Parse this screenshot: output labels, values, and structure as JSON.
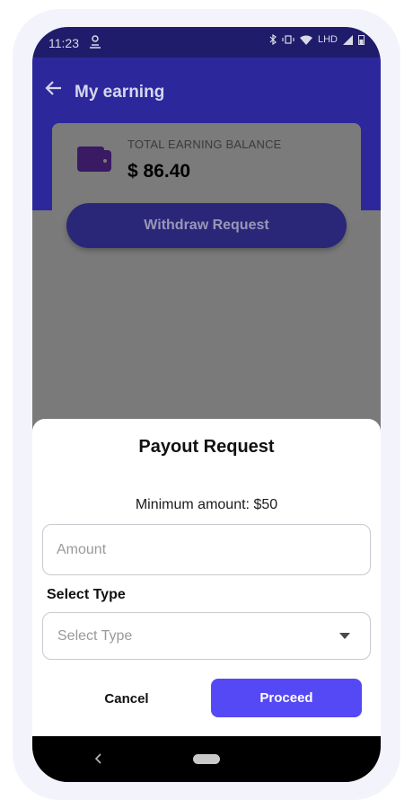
{
  "status_bar": {
    "time": "11:23",
    "right_text": "LHD"
  },
  "app_bar": {
    "title": "My earning"
  },
  "balance": {
    "label": "TOTAL EARNING BALANCE",
    "value": "$ 86.40"
  },
  "withdraw_button": "Withdraw Request",
  "payout_sheet": {
    "title": "Payout Request",
    "min_amount": "Minimum amount: $50",
    "amount_placeholder": "Amount",
    "select_label": "Select Type",
    "select_value": "Select Type",
    "cancel_label": "Cancel",
    "proceed_label": "Proceed"
  },
  "icons": {
    "back": "arrow-left-icon",
    "wallet": "wallet-icon",
    "caret": "caret-down-icon",
    "nav_back": "chevron-left-icon"
  },
  "colors": {
    "primary": "#2c289b",
    "proceed": "#5549f5",
    "wallet": "#6b2fb5"
  }
}
